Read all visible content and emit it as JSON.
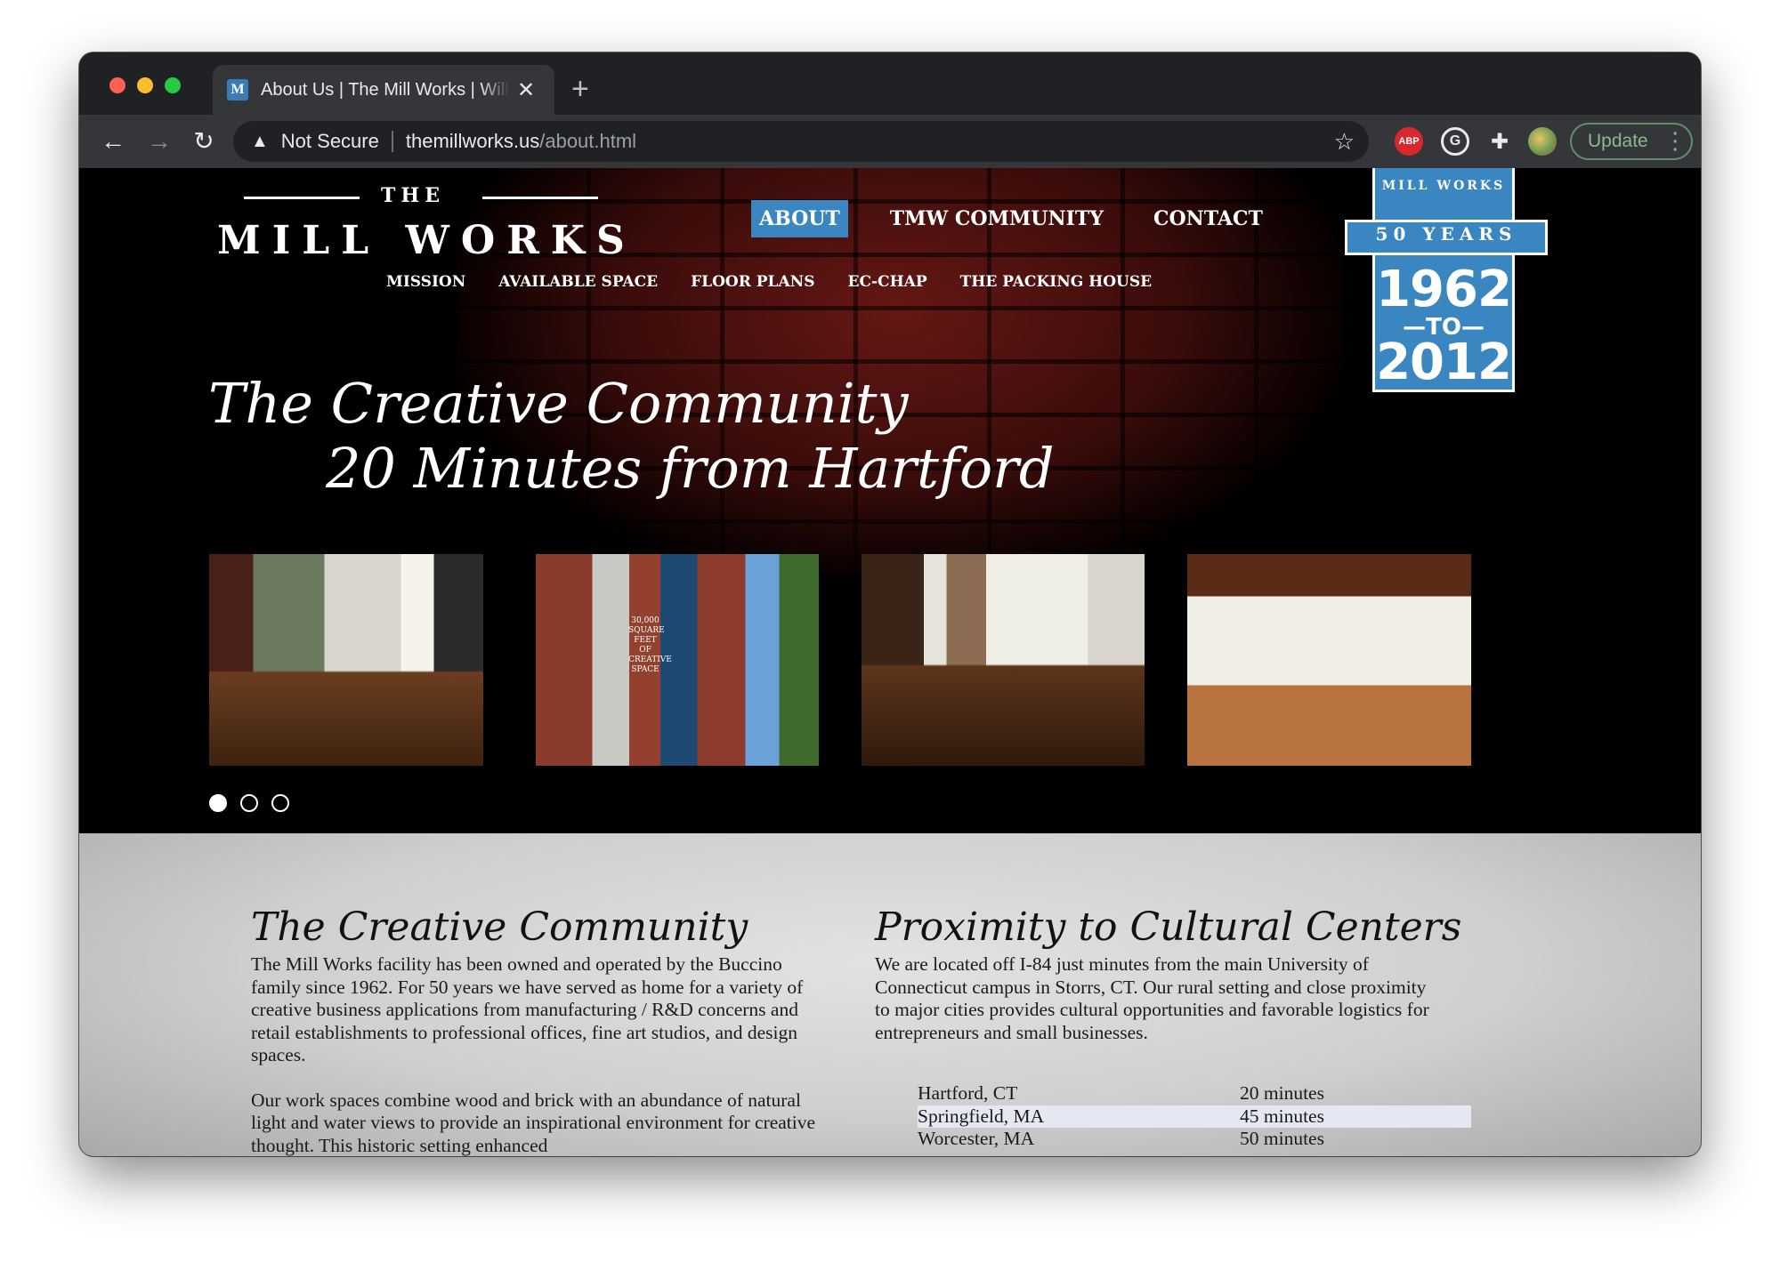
{
  "browser": {
    "tab_title": "About Us | The Mill Works | Willington, CT",
    "tab_favicon": "M",
    "new_tab": "+",
    "security": "Not Secure",
    "url_host": "themillworks.us",
    "url_path": "/about.html",
    "ext_abp": "ABP",
    "update_label": "Update"
  },
  "logo": {
    "the": "THE",
    "name": "MILL WORKS"
  },
  "nav": {
    "main": [
      {
        "label": "ABOUT",
        "active": true
      },
      {
        "label": "TMW COMMUNITY",
        "active": false
      },
      {
        "label": "CONTACT",
        "active": false
      }
    ],
    "sub": [
      "MISSION",
      "AVAILABLE SPACE",
      "FLOOR PLANS",
      "EC-CHAP",
      "THE PACKING HOUSE"
    ]
  },
  "badge": {
    "top": "MILL WORKS",
    "ribbon": "50 YEARS",
    "year_start": "1962",
    "to": "—TO—",
    "year_end": "2012"
  },
  "hero": {
    "line1": "The Creative Community",
    "line2": "20 Minutes from Hartford"
  },
  "slider": {
    "photo_alt": [
      "Open mill interior with windows",
      "30,000 square feet of creative space banner on brick building",
      "Wood floor loft with columns",
      "Large open hall with wooden ceiling beams"
    ],
    "banner_text": "30,000 SQUARE FEET OF CREATIVE SPACE",
    "dots": 3,
    "active_dot": 0
  },
  "content": {
    "left": {
      "heading": "The Creative Community",
      "p1": "The Mill Works facility has been owned and operated by the Buccino family since 1962. For 50 years we have served as home for a variety of creative business applications from manufacturing / R&D concerns and retail establishments to professional offices, fine art studios, and design spaces.",
      "p2": "Our work spaces combine wood and brick with an abundance of natural light and water views to provide an inspirational environment for creative thought. This historic setting enhanced"
    },
    "right": {
      "heading": "Proximity to Cultural Centers",
      "p1": "We are located off I-84 just minutes from the main University of Connecticut campus in Storrs, CT. Our rural setting and close proximity to major cities provides cultural opportunities and favorable logistics for entrepreneurs and small businesses."
    },
    "distances": [
      {
        "city": "Hartford, CT",
        "time": "20 minutes"
      },
      {
        "city": "Springfield, MA",
        "time": "45 minutes"
      },
      {
        "city": "Worcester, MA",
        "time": "50 minutes"
      }
    ]
  },
  "colors": {
    "accent_blue": "#3a86c0",
    "chrome_dark": "#202124",
    "chrome_toolbar": "#35363a"
  }
}
